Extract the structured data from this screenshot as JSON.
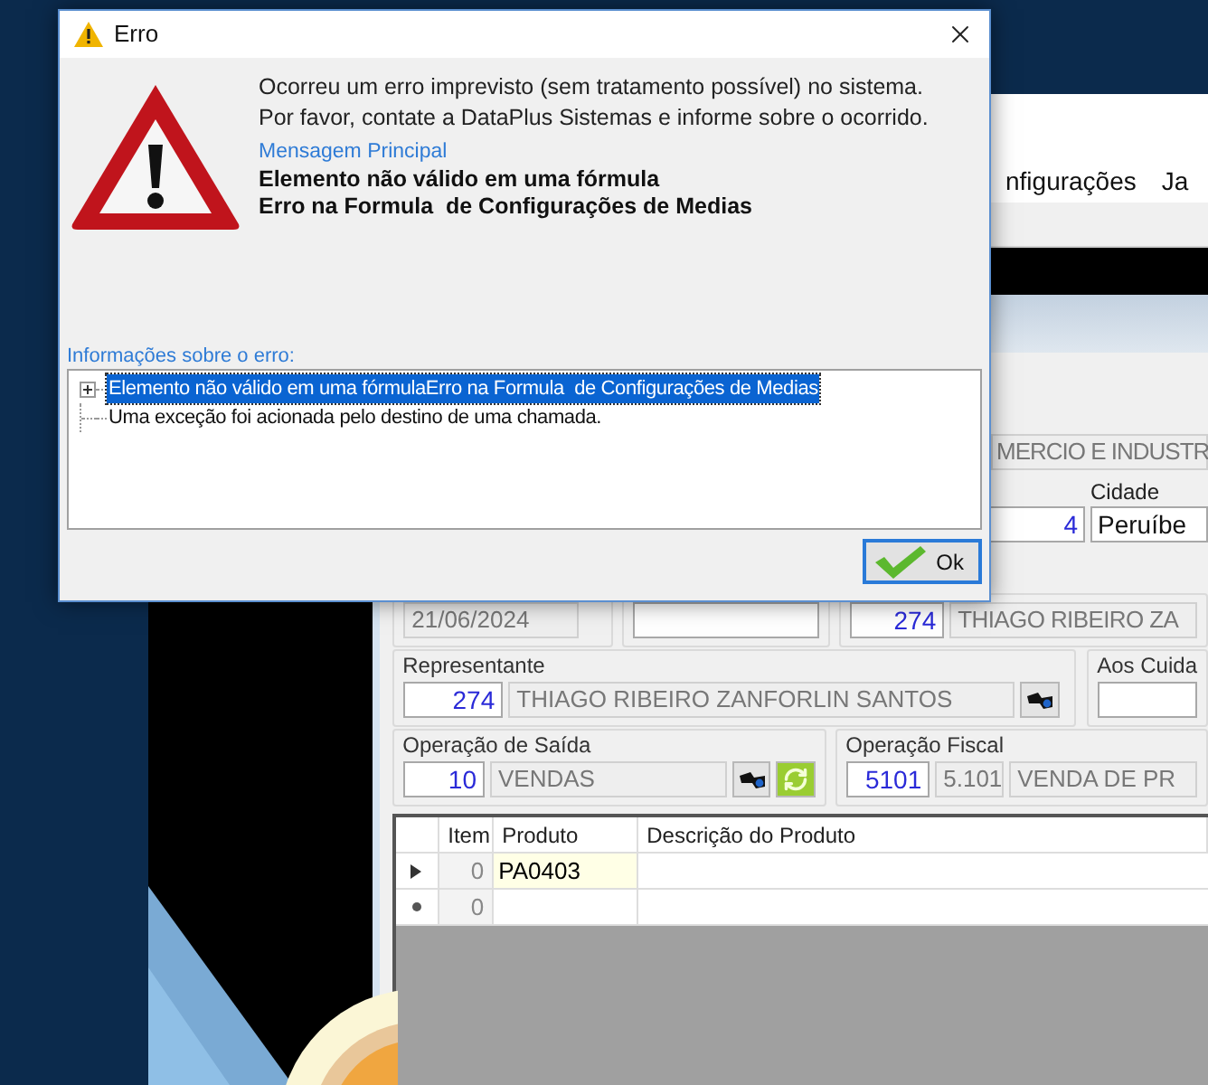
{
  "app": {
    "menu": [
      {
        "label": "nfigurações"
      },
      {
        "label": "Ja"
      }
    ],
    "company": "MERCIO E INDUSTR",
    "city_label": "Cidade",
    "city_code": "4",
    "city": "Peruíbe",
    "date": "21/06/2024",
    "client_code": "274",
    "client_name": "THIAGO RIBEIRO ZA",
    "representative": {
      "label": "Representante",
      "code": "274",
      "name": "THIAGO RIBEIRO ZANFORLIN SANTOS"
    },
    "care_label": "Aos Cuida",
    "exit_operation": {
      "label": "Operação de Saída",
      "code": "10",
      "name": "VENDAS"
    },
    "fiscal_operation": {
      "label": "Operação Fiscal",
      "code": "5101",
      "cfop": "5.101",
      "name": "VENDA DE PR"
    },
    "grid": {
      "columns": [
        "Item",
        "Produto",
        "Descrição do Produto"
      ],
      "rows": [
        {
          "kind": "current",
          "selected": true,
          "item": "0",
          "product": "PA0403"
        },
        {
          "kind": "new",
          "selected": false,
          "item": "0"
        }
      ]
    }
  },
  "dialog": {
    "title": "Erro",
    "message_lines": [
      "Ocorreu um erro imprevisto (sem tratamento possível) no sistema.",
      "Por favor, contate a DataPlus Sistemas e informe sobre o ocorrido."
    ],
    "main_label": "Mensagem Principal",
    "main_lines": [
      "Elemento não válido em uma fórmula",
      "Erro na Formula  de Configurações de Medias"
    ],
    "details_label": "Informações sobre o erro:",
    "details_tree": [
      {
        "text": "Elemento não válido em uma fórmulaErro na Formula  de Configurações de Medias",
        "selected": true,
        "expanded": false
      },
      {
        "text": "Uma exceção foi acionada pelo destino de uma chamada.",
        "selected": false
      }
    ],
    "ok_button": "Ok"
  }
}
